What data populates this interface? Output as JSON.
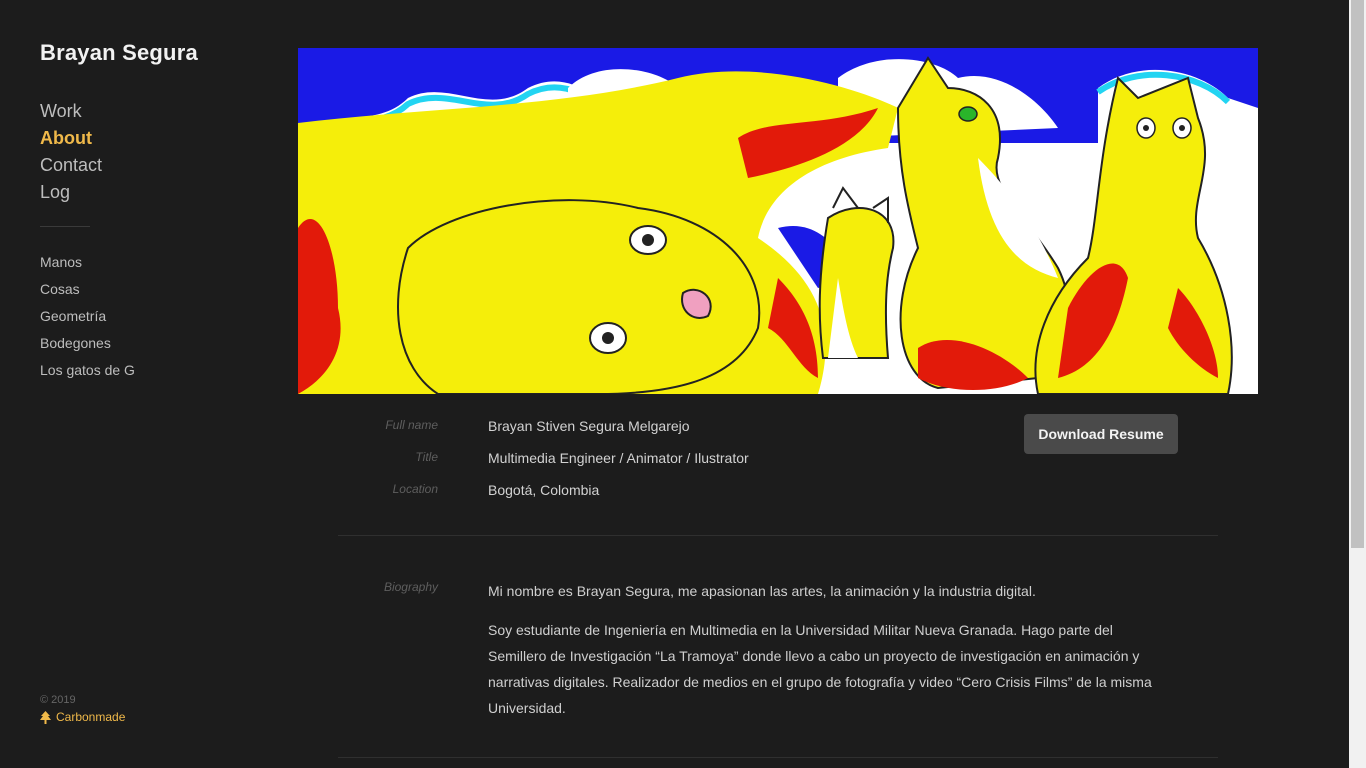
{
  "site": {
    "name": "Brayan Segura"
  },
  "nav": {
    "main": [
      {
        "label": "Work",
        "active": false
      },
      {
        "label": "About",
        "active": true
      },
      {
        "label": "Contact",
        "active": false
      },
      {
        "label": "Log",
        "active": false
      }
    ],
    "projects": [
      "Manos",
      "Cosas",
      "Geometría",
      "Bodegones",
      "Los gatos de G"
    ]
  },
  "footer": {
    "copyright": "© 2019",
    "platform": "Carbonmade",
    "platform_icon": "tree-icon"
  },
  "hero": {
    "image_icon": "cats-illustration"
  },
  "details": {
    "full_name_label": "Full name",
    "full_name": "Brayan Stiven Segura Melgarejo",
    "title_label": "Title",
    "title": "Multimedia Engineer / Animator / Ilustrator",
    "location_label": "Location",
    "location": "Bogotá, Colombia",
    "download_label": "Download Resume"
  },
  "biography": {
    "label": "Biography",
    "paragraphs": [
      "Mi nombre es Brayan Segura, me apasionan las artes, la animación y la industria digital.",
      "Soy estudiante de Ingeniería en Multimedia en la Universidad Militar Nueva Granada. Hago parte del Semillero de Investigación “La Tramoya” donde llevo a cabo un proyecto de investigación en animación y narrativas digitales. Realizador de medios en el grupo de fotografía y video “Cero Crisis Films” de la misma Universidad."
    ]
  },
  "colors": {
    "background": "#1c1c1c",
    "accent": "#f0b94a",
    "button": "#4a4a4a"
  }
}
